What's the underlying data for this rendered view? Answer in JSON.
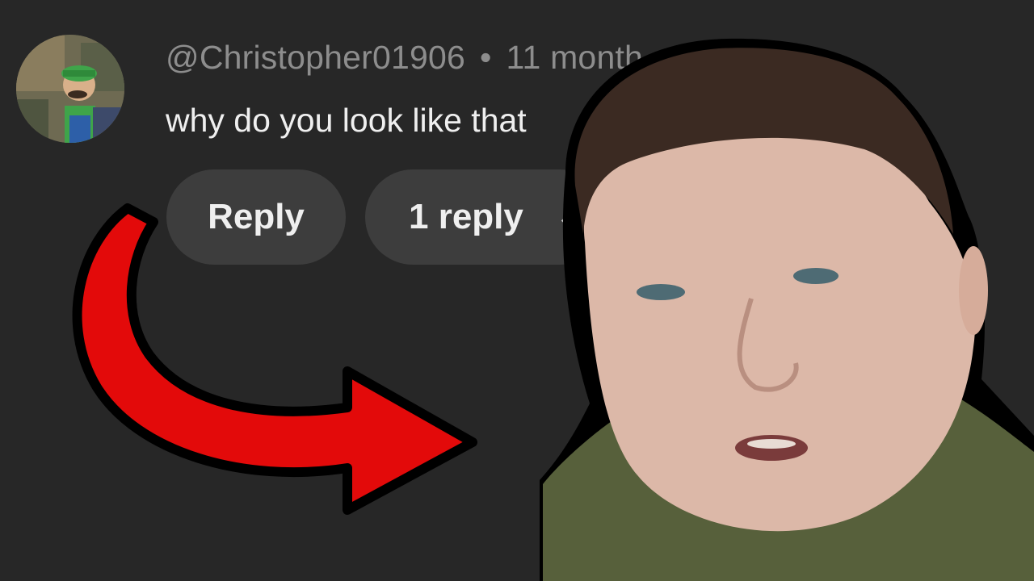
{
  "comment": {
    "username": "@Christopher01906",
    "separator": "•",
    "timestamp": "11 month",
    "text": "why do you look like that"
  },
  "actions": {
    "reply_label": "Reply",
    "replies_label": "1 reply",
    "expand_icon": "chevron-down-icon"
  },
  "overlay": {
    "arrow_color": "#e30a0a",
    "arrow_outline": "#000000"
  }
}
